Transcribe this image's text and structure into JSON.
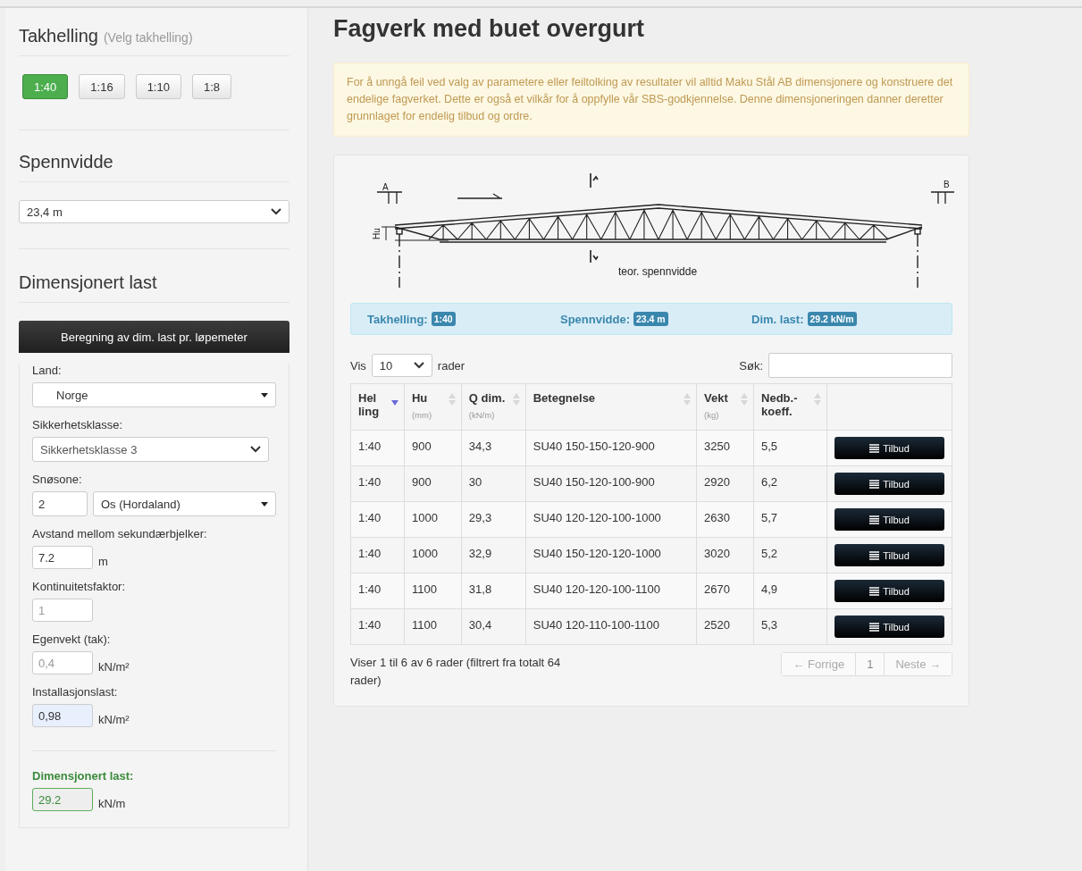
{
  "sidebar": {
    "slope": {
      "title": "Takhelling",
      "hint": "(Velg takhelling)",
      "options": [
        {
          "label": "1:40",
          "selected": true
        },
        {
          "label": "1:16",
          "selected": false
        },
        {
          "label": "1:10",
          "selected": false
        },
        {
          "label": "1:8",
          "selected": false
        }
      ]
    },
    "span": {
      "title": "Spennvidde",
      "value": "23,4 m"
    },
    "load": {
      "title": "Dimensjonert last",
      "calc_button": "Beregning av dim. last pr. løpemeter",
      "fields": [
        {
          "kind": "fancyselect",
          "label": "Land:",
          "value": "Norge"
        },
        {
          "kind": "select",
          "label": "Sikkerhetsklasse:",
          "value": "Sikkerhetsklasse 3"
        },
        {
          "kind": "zone",
          "label": "Snøsone:",
          "value": "2",
          "select": "Os (Hordaland)"
        },
        {
          "kind": "input",
          "label": "Avstand mellom sekundærbjelker:",
          "value": "7.2",
          "unit": "m",
          "disabled": false,
          "highlighted": false
        },
        {
          "kind": "input",
          "label": "Kontinuitetsfaktor:",
          "value": "1",
          "disabled": true,
          "highlighted": false
        },
        {
          "kind": "input",
          "label": "Egenvekt (tak):",
          "value": "0,4",
          "unit": "kN/m²",
          "disabled": true,
          "highlighted": false
        },
        {
          "kind": "input",
          "label": "Installasjonslast:",
          "value": "0,98",
          "unit": "kN/m²",
          "disabled": false,
          "highlighted": true
        },
        {
          "kind": "result",
          "label": "Dimensjonert last:",
          "value": "29.2",
          "unit": "kN/m"
        }
      ]
    }
  },
  "main": {
    "title": "Fagverk med buet overgurt",
    "notice": "For å unngå feil ved valg av parametere eller feiltolking av resultater vil alltid Maku Stål AB dimensjonere og konstruere det endelige fagverket. Dette er også et vilkår for å oppfylle vår SBS-godkjennelse. Denne dimensjoneringen danner deretter grunnlaget for endelig tilbud og ordre.",
    "diagram": {
      "label_a": "A",
      "label_b": "B",
      "label_hu": "Hu",
      "caption": "teor. spennvidde"
    },
    "summary": [
      {
        "label": "Takhelling:",
        "value": "1:40"
      },
      {
        "label": "Spennvidde:",
        "value": "23.4 m"
      },
      {
        "label": "Dim. last:",
        "value": "29.2 kN/m"
      }
    ],
    "table": {
      "show_label": "Vis",
      "page_size": "10",
      "rows_label": "rader",
      "search_label": "Søk:",
      "columns": [
        {
          "title": "Hel ling",
          "sortable": true,
          "sorted_desc": true
        },
        {
          "title": "Hu",
          "unit": "(mm)",
          "sortable": true,
          "sorted_desc": false
        },
        {
          "title": "Q dim.",
          "unit": "(kN/m)",
          "sortable": true,
          "sorted_desc": false
        },
        {
          "title": "Betegnelse",
          "sortable": true,
          "sorted_desc": false
        },
        {
          "title": "Vekt",
          "unit": "(kg)",
          "sortable": true,
          "sorted_desc": false
        },
        {
          "title": "Nedb.-koeff.",
          "sortable": true,
          "sorted_desc": false
        },
        {
          "sortable": false,
          "sorted_desc": false
        }
      ],
      "rows": [
        {
          "cells": [
            "1:40",
            "900",
            "34,3",
            "SU40 150-150-120-900",
            "3250",
            "5,5"
          ],
          "button": "Tilbud"
        },
        {
          "cells": [
            "1:40",
            "900",
            "30",
            "SU40 150-120-100-900",
            "2920",
            "6,2"
          ],
          "button": "Tilbud"
        },
        {
          "cells": [
            "1:40",
            "1000",
            "29,3",
            "SU40 120-120-100-1000",
            "2630",
            "5,7"
          ],
          "button": "Tilbud"
        },
        {
          "cells": [
            "1:40",
            "1000",
            "32,9",
            "SU40 150-120-120-1000",
            "3020",
            "5,2"
          ],
          "button": "Tilbud"
        },
        {
          "cells": [
            "1:40",
            "1100",
            "31,8",
            "SU40 120-120-100-1100",
            "2670",
            "4,9"
          ],
          "button": "Tilbud"
        },
        {
          "cells": [
            "1:40",
            "1100",
            "30,4",
            "SU40 120-110-100-1100",
            "2520",
            "5,3"
          ],
          "button": "Tilbud"
        }
      ],
      "info": "Viser 1 til 6 av 6 rader (filtrert fra totalt 64 rader)",
      "pagination": [
        {
          "label": "← Forrige",
          "disabled": true
        },
        {
          "label": "1",
          "disabled": false
        },
        {
          "label": "Neste →",
          "disabled": true
        }
      ]
    }
  }
}
